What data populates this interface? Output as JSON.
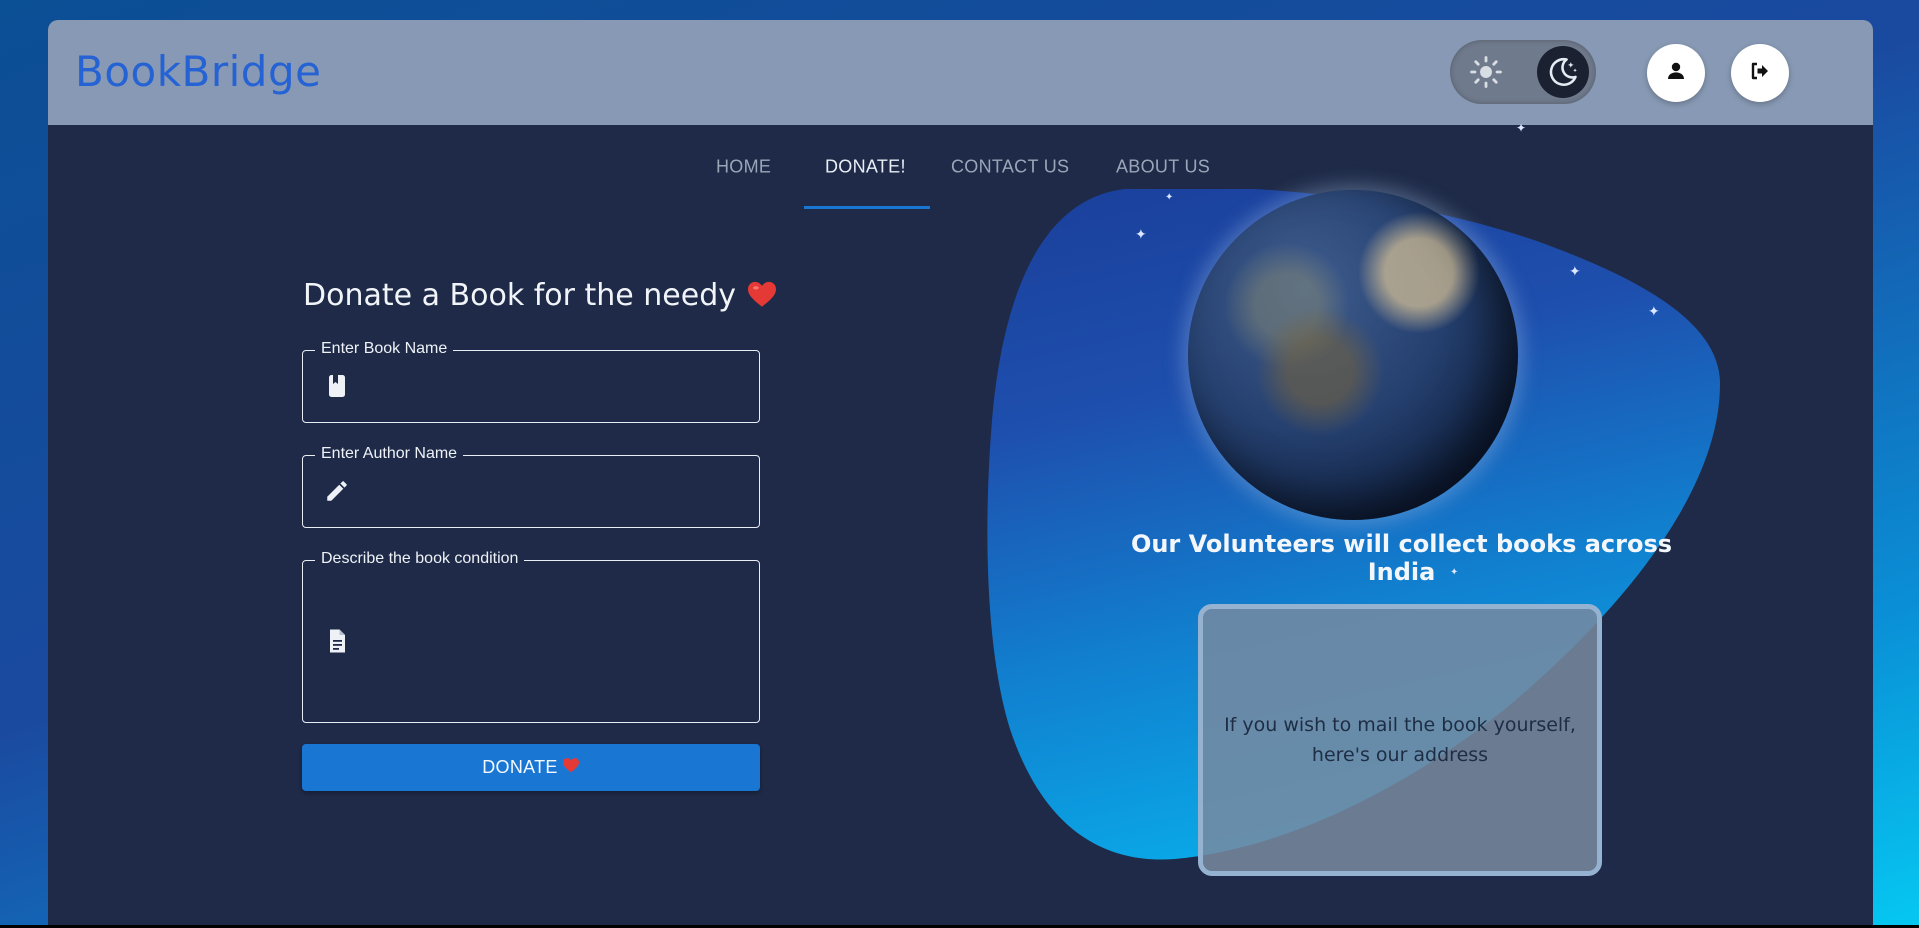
{
  "app": {
    "logo_text": "BookBridge"
  },
  "header": {
    "theme_toggle": {
      "light_icon": "sun-icon",
      "dark_icon": "moon-stars-icon",
      "selected": "dark"
    },
    "profile_icon": "user-icon",
    "logout_icon": "logout-icon"
  },
  "nav": {
    "tabs": [
      {
        "label": "HOME"
      },
      {
        "label": "DONATE!"
      },
      {
        "label": "CONTACT US"
      },
      {
        "label": "ABOUT US"
      }
    ],
    "active_tab": "DONATE!"
  },
  "form": {
    "title": "Donate a Book for the needy",
    "title_emoji": "heart-icon",
    "fields": [
      {
        "label": "Enter Book Name",
        "icon": "book-icon",
        "value": ""
      },
      {
        "label": "Enter Author Name",
        "icon": "pencil-icon",
        "value": ""
      },
      {
        "label": "Describe the book condition",
        "icon": "document-icon",
        "value": ""
      }
    ],
    "submit_label": "DONATE"
  },
  "info": {
    "volunteer_text": "Our Volunteers will collect books across India",
    "address_text": "If you wish to mail the book yourself,\nhere's our address"
  },
  "colors": {
    "page_gradient_start": "#0b4f95",
    "page_gradient_end": "#06c8f2",
    "panel": "#1e2a47",
    "header": "#8799b4",
    "logo": "#2563d4",
    "primary_button": "#1976d2",
    "heart": "#e53935"
  }
}
